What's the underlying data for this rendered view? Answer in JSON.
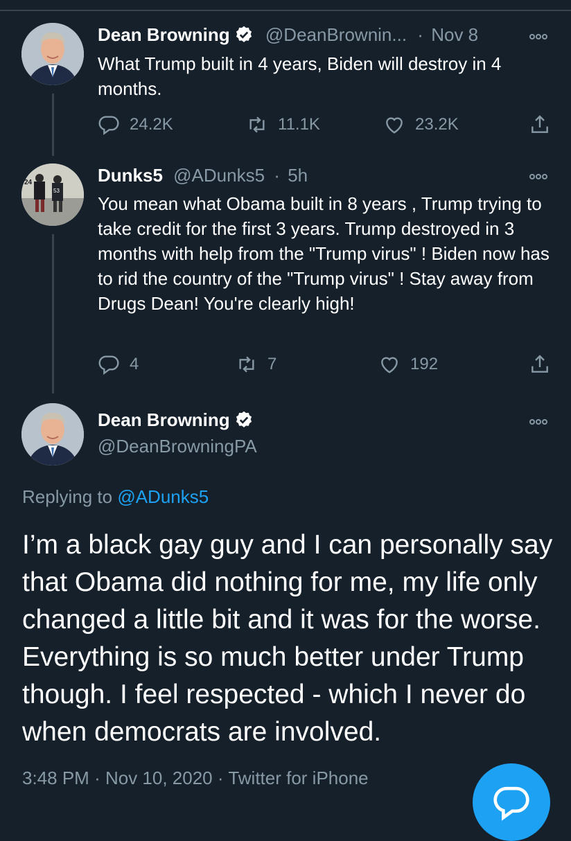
{
  "colors": {
    "background": "#15202b",
    "muted": "#8899a6",
    "accent": "#1da1f2",
    "divider": "#38444d",
    "text": "#ffffff"
  },
  "tweets": [
    {
      "display_name": "Dean Browning",
      "verified": true,
      "handle": "@DeanBrownin...",
      "separator": "·",
      "time": "Nov 8",
      "text": "What Trump built in 4 years, Biden will destroy in 4 months.",
      "stats": {
        "replies": "24.2K",
        "retweets": "11.1K",
        "likes": "23.2K"
      }
    },
    {
      "display_name": "Dunks5",
      "verified": false,
      "handle": "@ADunks5",
      "separator": "·",
      "time": "5h",
      "text": "You mean what Obama built in 8 years , Trump trying to take credit for the first 3 years. Trump destroyed in 3 months with help from the \"Trump virus\" ! Biden now has to rid the country of the \"Trump virus\" ! Stay away from Drugs Dean! You're clearly high!",
      "stats": {
        "replies": "4",
        "retweets": "7",
        "likes": "192"
      }
    }
  ],
  "focused": {
    "display_name": "Dean Browning",
    "verified": true,
    "handle": "@DeanBrowningPA",
    "replying_prefix": "Replying to",
    "replying_to": "@ADunks5",
    "text": "I’m a black gay guy and I can personally say that Obama did nothing for me, my life only changed a little bit and it was for the worse. Everything is so much better under Trump though. I feel respected - which I never do when democrats are involved.",
    "time": "3:48 PM",
    "date": "Nov 10, 2020",
    "source": "Twitter for iPhone",
    "sep1": "·",
    "sep2": "·"
  },
  "icons": [
    "verified-badge-icon",
    "more-options-icon",
    "reply-icon",
    "retweet-icon",
    "like-icon",
    "share-icon",
    "compose-icon"
  ]
}
